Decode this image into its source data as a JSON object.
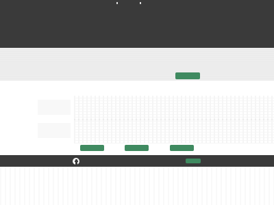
{
  "header": {
    "title": ""
  },
  "hero": {
    "cta_label": ""
  },
  "content": {
    "cta_labels": [
      "",
      "",
      ""
    ]
  },
  "footer": {
    "social": [
      "facebook-icon"
    ],
    "button_label": ""
  },
  "colors": {
    "header_bg": "#3a3a3a",
    "hero_bg": "#ededed",
    "accent_green": "#3f8a60",
    "footer_bg": "#3a3a3a"
  }
}
